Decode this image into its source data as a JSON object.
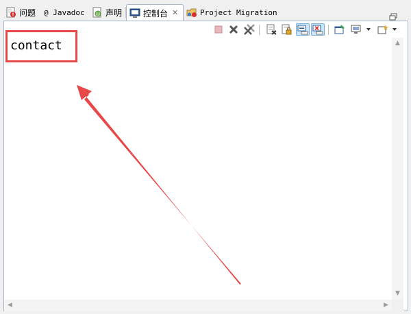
{
  "tabs": [
    {
      "label": "问题",
      "icon": "problems-icon"
    },
    {
      "label": "@ Javadoc",
      "icon": "javadoc-icon"
    },
    {
      "label": "声明",
      "icon": "declaration-icon"
    },
    {
      "label": "控制台",
      "icon": "console-icon",
      "active": true
    },
    {
      "label": "Project Migration",
      "icon": "project-migration-icon"
    }
  ],
  "console": {
    "output": "contact"
  },
  "colors": {
    "highlight": "#e94848",
    "arrow": "#e94848",
    "panel_border": "#a6b6cc"
  },
  "toolbar_icons": [
    "terminate-icon",
    "remove-launch-icon",
    "remove-all-terminated-icon",
    "clear-console-icon",
    "scroll-lock-icon",
    "show-on-stdout-icon",
    "show-on-stderr-icon",
    "pin-console-icon",
    "display-selected-console-icon",
    "open-console-icon"
  ]
}
